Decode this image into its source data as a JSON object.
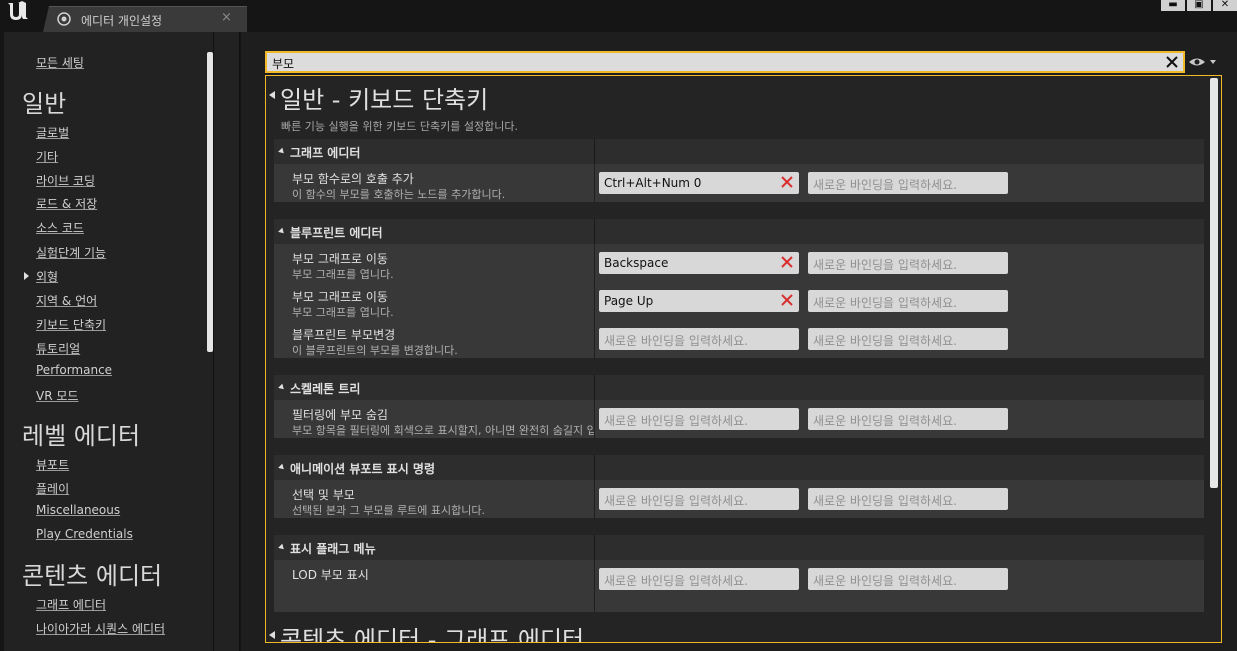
{
  "window": {
    "tab_title": "에디터 개인설정",
    "tab_close": "×",
    "btn_minimize": "▬",
    "btn_maximize": "▣",
    "btn_close": "✕"
  },
  "sidebar": {
    "all_settings": "모든 세팅",
    "general_header": "일반",
    "general_items": [
      "글로벌",
      "기타",
      "라이브 코딩",
      "로드 & 저장",
      "소스 코드",
      "실험단계 기능",
      "외형",
      "지역 & 언어",
      "키보드 단축키",
      "튜토리얼",
      "Performance",
      "VR 모드"
    ],
    "level_header": "레벨 에디터",
    "level_items": [
      "뷰포트",
      "플레이",
      "Miscellaneous",
      "Play Credentials"
    ],
    "content_header": "콘텐츠 에디터",
    "content_items": [
      "그래프 에디터",
      "나이아가라 시퀀스 에디터"
    ]
  },
  "search": {
    "value": "부모"
  },
  "section": {
    "title": "일반 - 키보드 단축키",
    "description": "빠른 기능 실행을 위한 키보드 단축키를 설정합니다.",
    "next_title": "콘텐츠 에디터 - 그래프 에디터"
  },
  "placeholder": "새로운 바인딩을 입력하세요.",
  "groups": [
    {
      "title": "그래프 에디터",
      "rows": [
        {
          "name": "부모 함수로의 호출 추가",
          "desc": "이 함수의 부모를 호출하는 노드를 추가합니다.",
          "binding1": "Ctrl+Alt+Num 0"
        }
      ]
    },
    {
      "title": "블루프린트 에디터",
      "rows": [
        {
          "name": "부모 그래프로 이동",
          "desc": "부모 그래프를 엽니다.",
          "binding1": "Backspace"
        },
        {
          "name": "부모 그래프로 이동",
          "desc": "부모 그래프를 엽니다.",
          "binding1": "Page Up"
        },
        {
          "name": "블루프린트 부모변경",
          "desc": "이 블루프린트의 부모를 변경합니다.",
          "binding1": ""
        }
      ]
    },
    {
      "title": "스켈레톤 트리",
      "rows": [
        {
          "name": "필터링에 부모 숨김",
          "desc": "부모 항목을 필터링에 회색으로 표시할지, 아니면 완전히 숨길지 입니",
          "binding1": ""
        }
      ]
    },
    {
      "title": "애니메이션 뷰포트 표시 명령",
      "rows": [
        {
          "name": "선택 및 부모",
          "desc": "선택된 본과 그 부모를 루트에 표시합니다.",
          "binding1": ""
        }
      ]
    },
    {
      "title": "표시 플래그 메뉴",
      "rows": [
        {
          "name": "LOD 부모 표시",
          "desc": "",
          "binding1": ""
        }
      ]
    }
  ],
  "colors": {
    "accent": "#f0b92a",
    "clear_x": "#d83030"
  }
}
